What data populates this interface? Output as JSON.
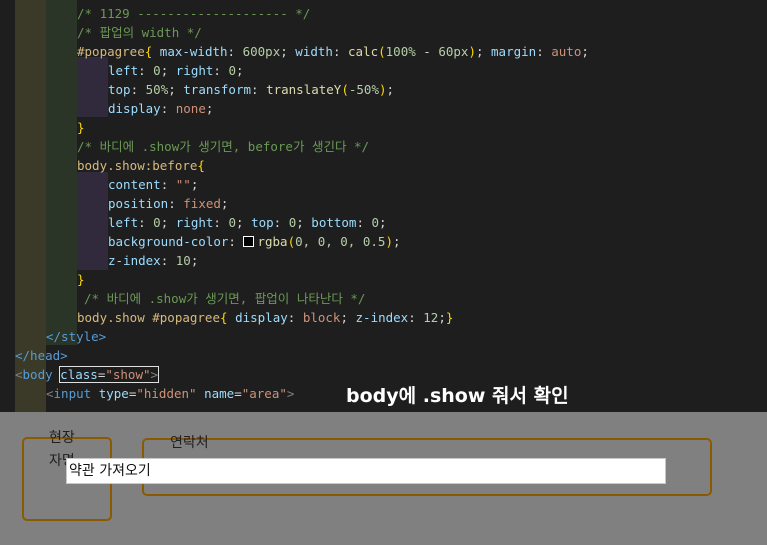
{
  "code_lines": {
    "l0": "/* 1129 -------------------- */",
    "l1": "/* 팝업의 width */",
    "l2_sel": "#popagree",
    "l2_brace": "{",
    "l2_p1": "max-width",
    "l2_v1": "600px",
    "l2_p2": "width",
    "l2_fn": "calc",
    "l2_v2a": "100%",
    "l2_op": " - ",
    "l2_v2b": "60px",
    "l2_p3": "margin",
    "l2_v3": "auto",
    "l3_p1": "left",
    "l3_v1": "0",
    "l3_p2": "right",
    "l3_v2": "0",
    "l4_p1": "top",
    "l4_v1": "50%",
    "l4_p2": "transform",
    "l4_fn": "translateY",
    "l4_v2": "-50%",
    "l5_p": "display",
    "l5_v": "none",
    "l6": "}",
    "l7": "/* 바디에 .show가 생기면, before가 생긴다 */",
    "l8_sel": "body.show:before",
    "l8_brace": "{",
    "l9_p": "content",
    "l9_v": "\"\"",
    "l10_p": "position",
    "l10_v": "fixed",
    "l11_p1": "left",
    "l11_v1": "0",
    "l11_p2": "right",
    "l11_v2": "0",
    "l11_p3": "top",
    "l11_v3": "0",
    "l11_p4": "bottom",
    "l11_v4": "0",
    "l12_p": "background-color",
    "l12_fn": "rgba",
    "l12_v": "0, 0, 0, 0.5",
    "l13_p": "z-index",
    "l13_v": "10",
    "l14": "}",
    "l15": "/* 바디에 .show가 생기면, 팝업이 나타난다 */",
    "l16_sel": "body.show #popagree",
    "l16_brace": "{",
    "l16_p1": "display",
    "l16_v1": "block",
    "l16_p2": "z-index",
    "l16_v2": "12",
    "l16_close": "}",
    "l17_tag": "</style>",
    "l18_tag": "</head>",
    "l19_open": "<",
    "l19_tag": "body",
    "l19_attr": "class",
    "l19_val": "\"show\"",
    "l19_close": ">",
    "l20_tag": "input",
    "l20_attr1": "type",
    "l20_val1": "\"hidden\"",
    "l20_attr2": "name",
    "l20_val2": "\"area\""
  },
  "annotation": "body에 .show 줘서 확인",
  "colors": {
    "overlay": "#808080",
    "box_border": "#8b5a00",
    "swatch": "#000000"
  },
  "page": {
    "label_a": "현장",
    "label_b": "자명",
    "label_c": "연락처",
    "terms_field": "약관 가져오기"
  }
}
